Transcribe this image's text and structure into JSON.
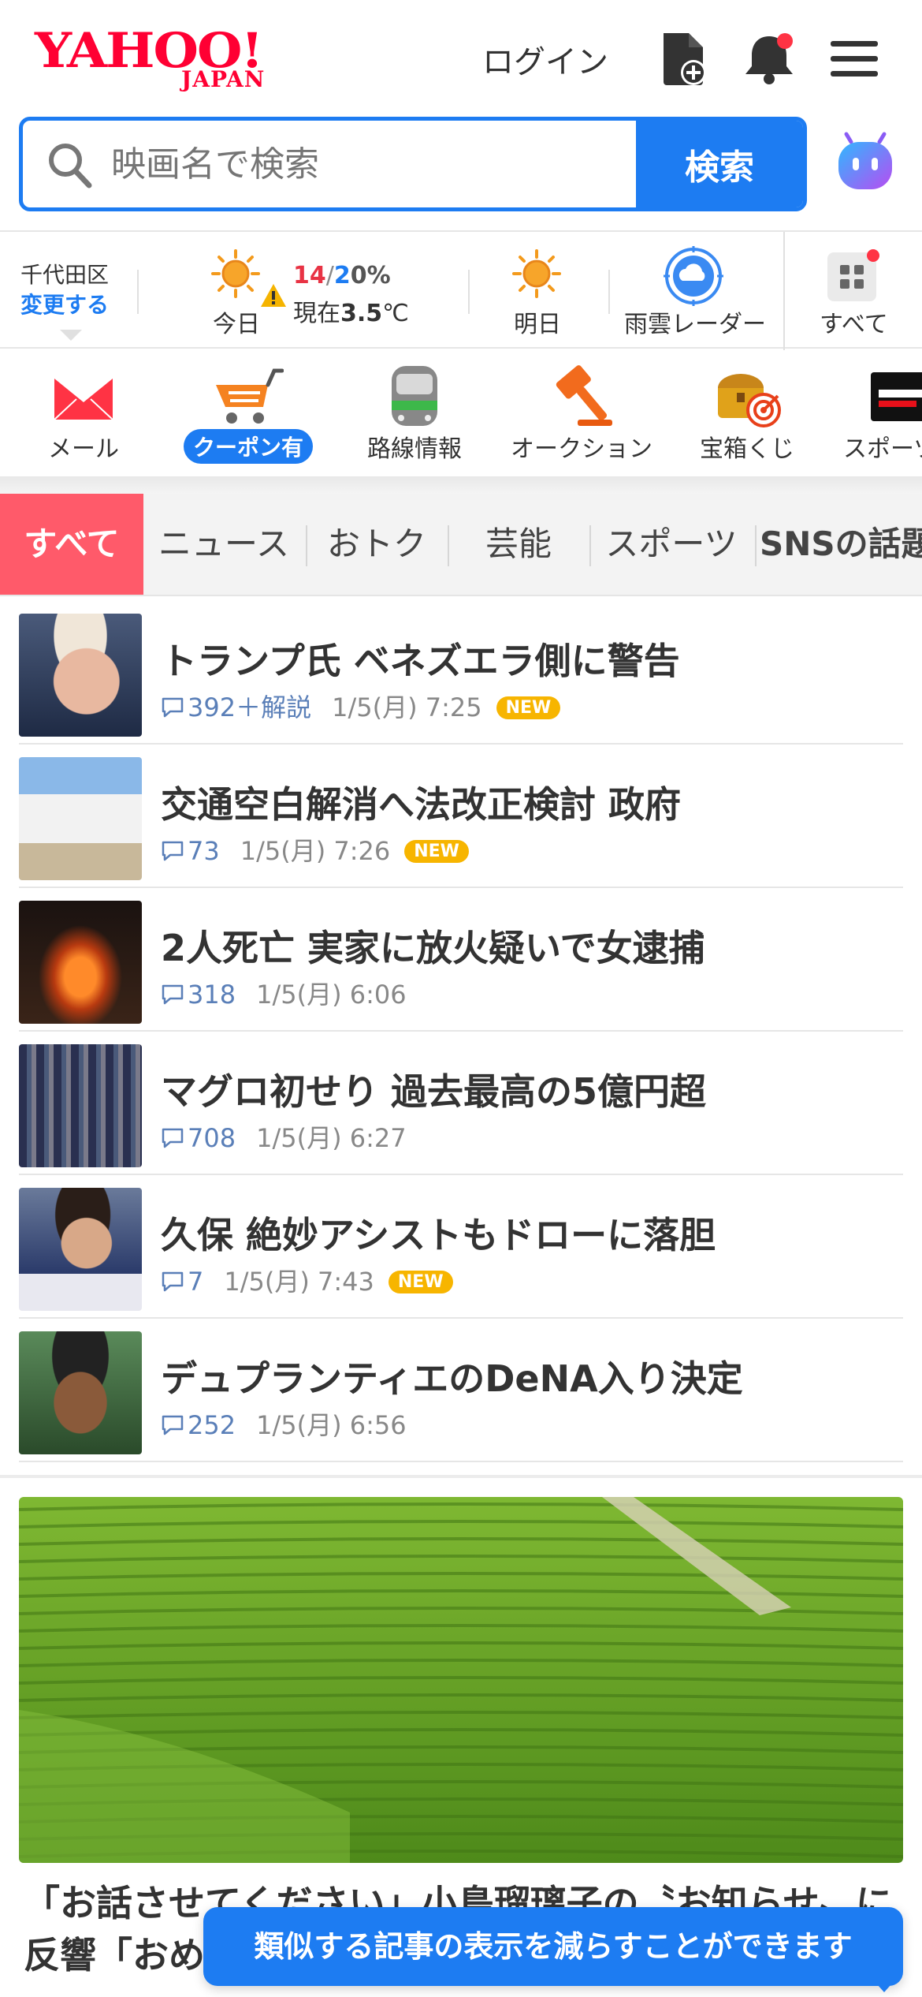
{
  "header": {
    "logo_main": "YAHOO!",
    "logo_sub": "JAPAN",
    "login_label": "ログイン"
  },
  "search": {
    "placeholder": "映画名で検索",
    "button_label": "検索"
  },
  "weather": {
    "area": "千代田区",
    "change_label": "変更する",
    "today_label": "今日",
    "high": "14",
    "slash": "/",
    "low": "2",
    "precip": "0%",
    "now_prefix": "現在",
    "now_temp": "3.5",
    "now_unit": "℃",
    "tomorrow_label": "明日",
    "radar_label": "雨雲レーダー",
    "all_label": "すべて"
  },
  "services": [
    {
      "label": "メール",
      "icon": "mail-icon"
    },
    {
      "label": "クーポン有",
      "icon": "cart-icon"
    },
    {
      "label": "路線情報",
      "icon": "train-icon"
    },
    {
      "label": "オークション",
      "icon": "auction-icon"
    },
    {
      "label": "宝箱くじ",
      "icon": "treasure-icon"
    },
    {
      "label": "スポーツ",
      "icon": "sports-icon"
    }
  ],
  "tabs": [
    {
      "label": "すべて",
      "active": true
    },
    {
      "label": "ニュース"
    },
    {
      "label": "おトク"
    },
    {
      "label": "芸能"
    },
    {
      "label": "スポーツ"
    },
    {
      "label": "SNSの話題"
    }
  ],
  "news": [
    {
      "title": "トランプ氏 ベネズエラ側に警告",
      "comments": "392",
      "extra": "＋解説",
      "date": "1/5(月) 7:25",
      "new": true
    },
    {
      "title": "交通空白解消へ法改正検討 政府",
      "comments": "73",
      "extra": "",
      "date": "1/5(月) 7:26",
      "new": true
    },
    {
      "title": "2人死亡 実家に放火疑いで女逮捕",
      "comments": "318",
      "extra": "",
      "date": "1/5(月) 6:06",
      "new": false
    },
    {
      "title": "マグロ初せり 過去最高の5億円超",
      "comments": "708",
      "extra": "",
      "date": "1/5(月) 6:27",
      "new": false
    },
    {
      "title": "久保 絶妙アシストもドローに落胆",
      "comments": "7",
      "extra": "",
      "date": "1/5(月) 7:43",
      "new": true
    },
    {
      "title": "デュプランティエのDeNA入り決定",
      "comments": "252",
      "extra": "",
      "date": "1/5(月) 6:56",
      "new": false
    }
  ],
  "new_badge": "NEW",
  "feature": {
    "title": "「お話させてください」小島瑠璃子の〝お知らせ〟に反響「おめ"
  },
  "toast": "類似する記事の表示を減らすことができます",
  "colors": {
    "brand_red": "#ff0033",
    "accent_blue": "#1d7cf2",
    "tab_active": "#ff5a6a",
    "new_badge": "#f7b500"
  }
}
